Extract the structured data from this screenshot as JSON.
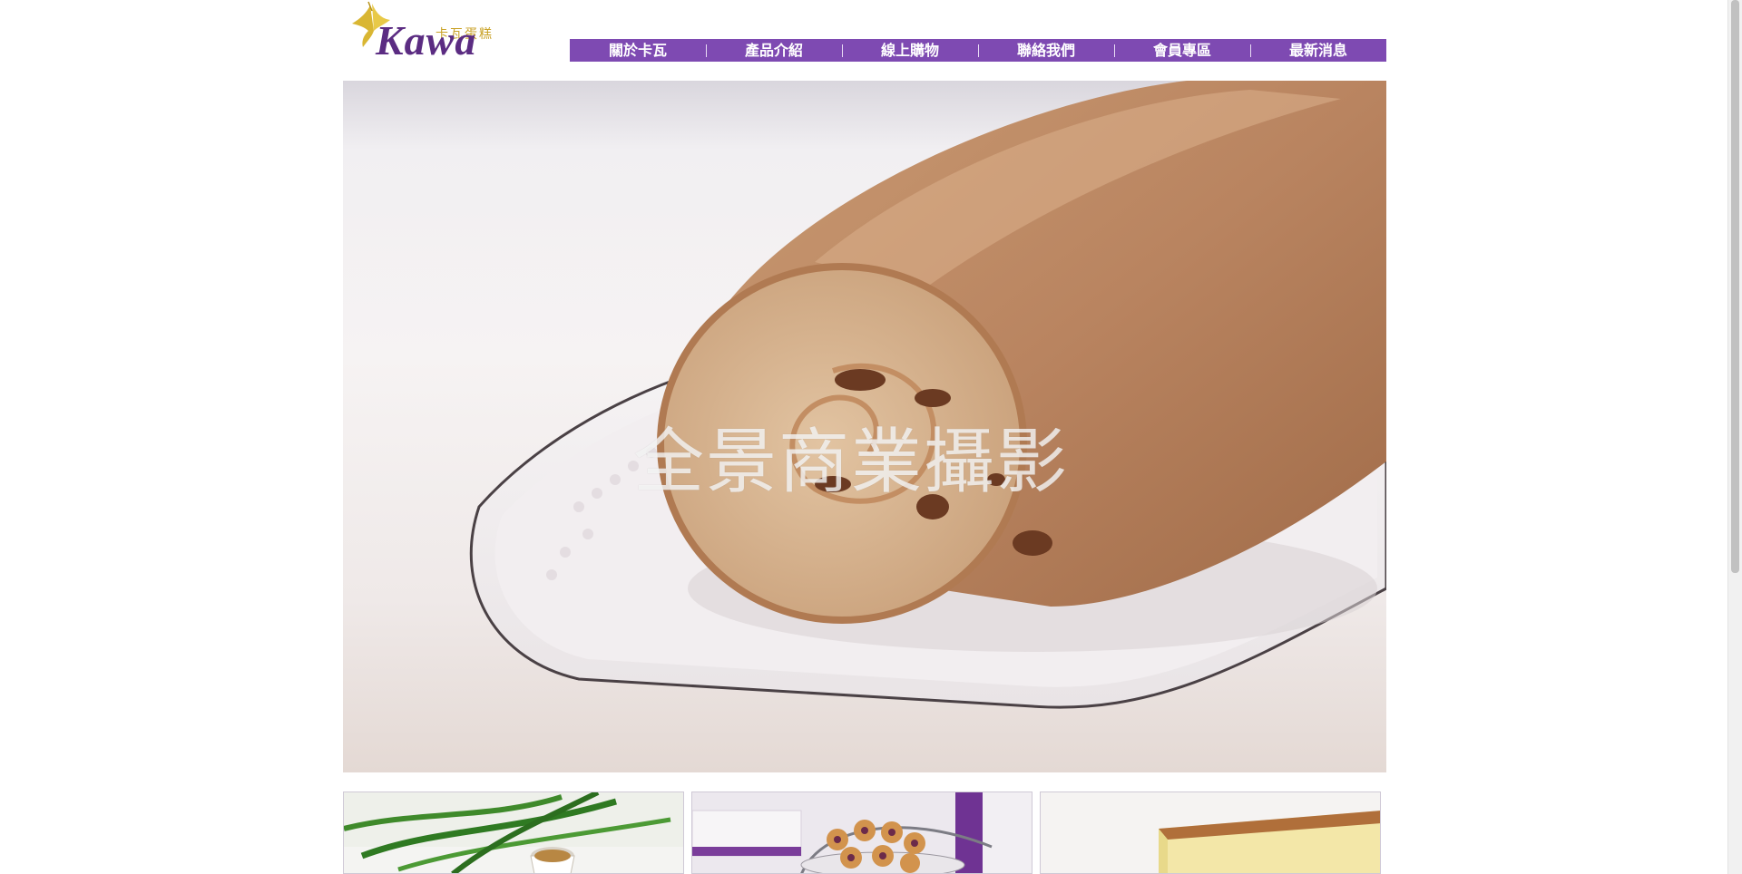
{
  "logo": {
    "brand": "Kawa",
    "chinese": "卡瓦蛋糕",
    "icon": "butterfly-icon"
  },
  "nav": {
    "items": [
      {
        "label": "關於卡瓦"
      },
      {
        "label": "產品介紹"
      },
      {
        "label": "線上購物"
      },
      {
        "label": "聯絡我們"
      },
      {
        "label": "會員專區"
      },
      {
        "label": "最新消息"
      }
    ]
  },
  "hero": {
    "watermark": "全景商業攝影"
  },
  "colors": {
    "nav_bg": "#7e4ab2",
    "logo_purple": "#5b2c82",
    "logo_gold": "#c9a227"
  }
}
